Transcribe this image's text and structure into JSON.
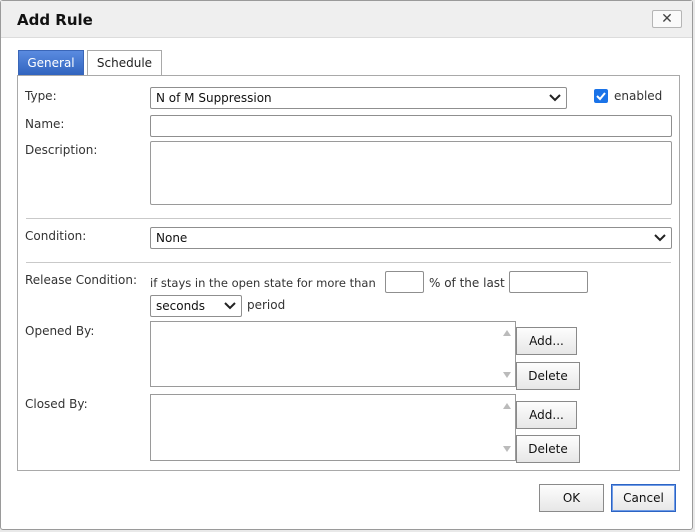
{
  "dialog": {
    "title": "Add Rule",
    "close_glyph": "✕"
  },
  "tabs": [
    {
      "label": "General",
      "active": true
    },
    {
      "label": "Schedule",
      "active": false
    }
  ],
  "form": {
    "type_label": "Type:",
    "type_value": "N of M Suppression",
    "enabled_label": "enabled",
    "enabled_checked": true,
    "name_label": "Name:",
    "name_value": "",
    "description_label": "Description:",
    "description_value": "",
    "condition_label": "Condition:",
    "condition_value": "None",
    "release_label": "Release Condition:",
    "release_text1": "if stays in the open state for more than",
    "release_percent_value": "",
    "release_text2": "% of the last",
    "release_last_value": "",
    "period_unit": "seconds",
    "period_label": "period",
    "opened_by_label": "Opened By:",
    "closed_by_label": "Closed By:",
    "add_label": "Add...",
    "delete_label": "Delete"
  },
  "footer": {
    "ok_label": "OK",
    "cancel_label": "Cancel"
  },
  "colors": {
    "accent": "#3d6fc7",
    "checkbox": "#1a73e8"
  }
}
